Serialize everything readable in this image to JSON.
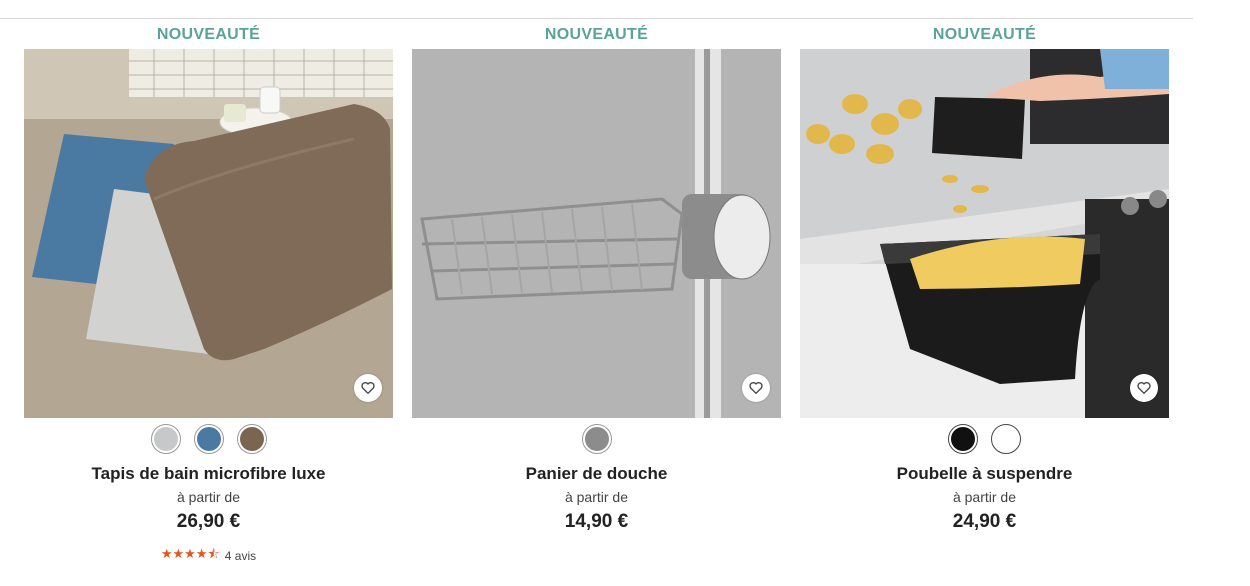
{
  "products": [
    {
      "badge": "NOUVEAUTÉ",
      "name": "Tapis de bain microfibre luxe",
      "from_label": "à partir de",
      "price": "26,90 €",
      "swatches": [
        "#c6c9c9",
        "#4a7aa1",
        "#7a6550"
      ],
      "rating": {
        "stars": "★★★★⯪",
        "value": 4.5,
        "reviews": "4 avis"
      }
    },
    {
      "badge": "NOUVEAUTÉ",
      "name": "Panier de douche",
      "from_label": "à partir de",
      "price": "14,90 €",
      "swatches": [
        "#8c8c8c"
      ]
    },
    {
      "badge": "NOUVEAUTÉ",
      "name": "Poubelle à suspendre",
      "from_label": "à partir de",
      "price": "24,90 €",
      "swatches": [
        "#111111",
        "#ffffff"
      ]
    }
  ],
  "icons": {
    "favorite": "heart-outline-icon"
  }
}
